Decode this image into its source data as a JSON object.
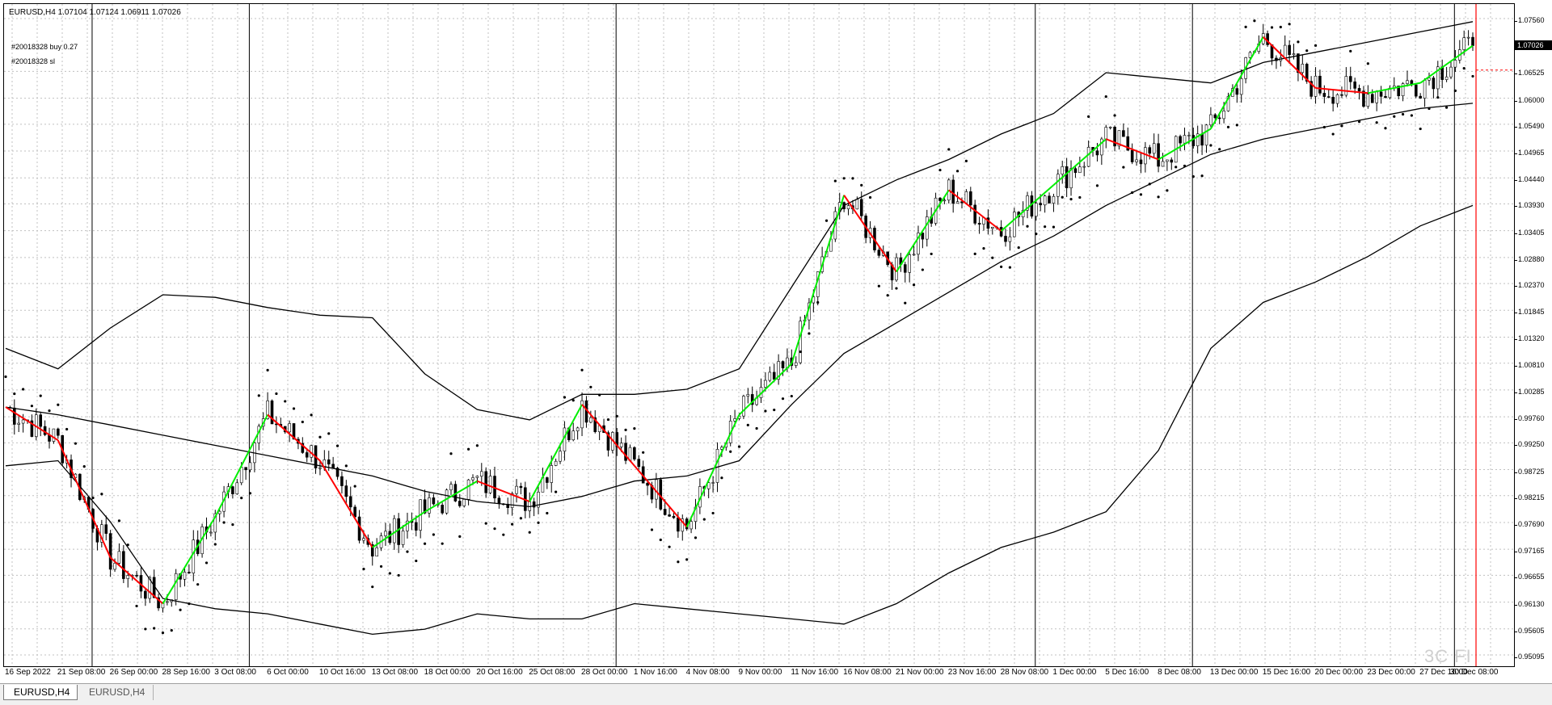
{
  "window": {
    "symbol_info": "EURUSD,H4  1.07104 1.07124 1.06911 1.07026"
  },
  "orders": [
    {
      "label": "#20018328 buy 0.27"
    },
    {
      "label": "#20018328 sl"
    }
  ],
  "price_scale": {
    "ticks": [
      "1.07560",
      "1.06525",
      "1.06000",
      "1.05490",
      "1.04965",
      "1.04440",
      "1.03930",
      "1.03405",
      "1.02880",
      "1.02370",
      "1.01845",
      "1.01320",
      "1.00810",
      "1.00285",
      "0.99760",
      "0.99250",
      "0.98725",
      "0.98215",
      "0.97690",
      "0.97165",
      "0.96655",
      "0.96130",
      "0.95605",
      "0.95095"
    ],
    "current_price": "1.07026"
  },
  "time_scale": {
    "labels": [
      "16 Sep 2022",
      "21 Sep 08:00",
      "26 Sep 00:00",
      "28 Sep 16:00",
      "3 Oct 08:00",
      "6 Oct 00:00",
      "10 Oct 16:00",
      "13 Oct 08:00",
      "18 Oct 00:00",
      "20 Oct 16:00",
      "25 Oct 08:00",
      "28 Oct 00:00",
      "1 Nov 16:00",
      "4 Nov 08:00",
      "9 Nov 00:00",
      "11 Nov 16:00",
      "16 Nov 08:00",
      "21 Nov 00:00",
      "23 Nov 16:00",
      "28 Nov 08:00",
      "1 Dec 00:00",
      "5 Dec 16:00",
      "8 Dec 08:00",
      "13 Dec 00:00",
      "15 Dec 16:00",
      "20 Dec 00:00",
      "23 Dec 00:00",
      "27 Dec 16:00",
      "30 Dec 08:00"
    ]
  },
  "tabs": [
    {
      "label": "EURUSD,H4",
      "active": true
    },
    {
      "label": "EURUSD,H4",
      "active": false
    }
  ],
  "watermark": "3C FI",
  "colors": {
    "candles": "#000000",
    "bollinger": "#000000",
    "parabolic_sar": "#000000",
    "zigzag_up": "#00ee00",
    "zigzag_down": "#ff0000",
    "period_separator": "#000000",
    "grid": "#c0c0c0",
    "current_bar_line": "#ff0000"
  },
  "chart_data": {
    "type": "candlestick",
    "symbol": "EURUSD",
    "timeframe": "H4",
    "last_bar": {
      "open": 1.07104,
      "high": 1.07124,
      "low": 1.06911,
      "close": 1.07026
    },
    "ylim": [
      0.95095,
      1.0756
    ],
    "x": [
      "16 Sep 2022",
      "21 Sep 08:00",
      "26 Sep 00:00",
      "28 Sep 16:00",
      "3 Oct 08:00",
      "6 Oct 00:00",
      "10 Oct 16:00",
      "13 Oct 08:00",
      "18 Oct 00:00",
      "20 Oct 16:00",
      "25 Oct 08:00",
      "28 Oct 00:00",
      "1 Nov 16:00",
      "4 Nov 08:00",
      "9 Nov 00:00",
      "11 Nov 16:00",
      "16 Nov 08:00",
      "21 Nov 00:00",
      "23 Nov 16:00",
      "28 Nov 08:00",
      "1 Dec 00:00",
      "5 Dec 16:00",
      "8 Dec 08:00",
      "13 Dec 00:00",
      "15 Dec 16:00",
      "20 Dec 00:00",
      "23 Dec 00:00",
      "27 Dec 16:00",
      "30 Dec 08:00"
    ],
    "price_path": [
      0.9995,
      0.993,
      0.97,
      0.961,
      0.978,
      0.998,
      0.989,
      0.972,
      0.979,
      0.985,
      0.981,
      1.0,
      0.988,
      0.976,
      0.998,
      1.008,
      1.041,
      1.026,
      1.042,
      1.034,
      1.043,
      1.052,
      1.048,
      1.054,
      1.072,
      1.062,
      1.061,
      1.063,
      1.0703
    ],
    "bollinger_upper": [
      1.011,
      1.007,
      1.015,
      1.0215,
      1.021,
      1.019,
      1.0175,
      1.017,
      1.006,
      0.999,
      0.997,
      1.002,
      1.002,
      1.003,
      1.007,
      1.023,
      1.039,
      1.044,
      1.048,
      1.053,
      1.057,
      1.065,
      1.064,
      1.063,
      1.067,
      1.069,
      1.071,
      1.073,
      1.075
    ],
    "bollinger_middle": [
      0.9995,
      0.998,
      0.996,
      0.994,
      0.992,
      0.99,
      0.988,
      0.986,
      0.983,
      0.981,
      0.98,
      0.982,
      0.985,
      0.986,
      0.989,
      1.0,
      1.01,
      1.016,
      1.022,
      1.028,
      1.033,
      1.039,
      1.044,
      1.049,
      1.052,
      1.054,
      1.056,
      1.058,
      1.059
    ],
    "bollinger_lower": [
      0.988,
      0.989,
      0.977,
      0.962,
      0.96,
      0.959,
      0.957,
      0.955,
      0.956,
      0.959,
      0.958,
      0.958,
      0.961,
      0.96,
      0.959,
      0.958,
      0.957,
      0.961,
      0.967,
      0.972,
      0.975,
      0.979,
      0.991,
      1.011,
      1.02,
      1.024,
      1.029,
      1.035,
      1.039
    ],
    "grid": true
  }
}
